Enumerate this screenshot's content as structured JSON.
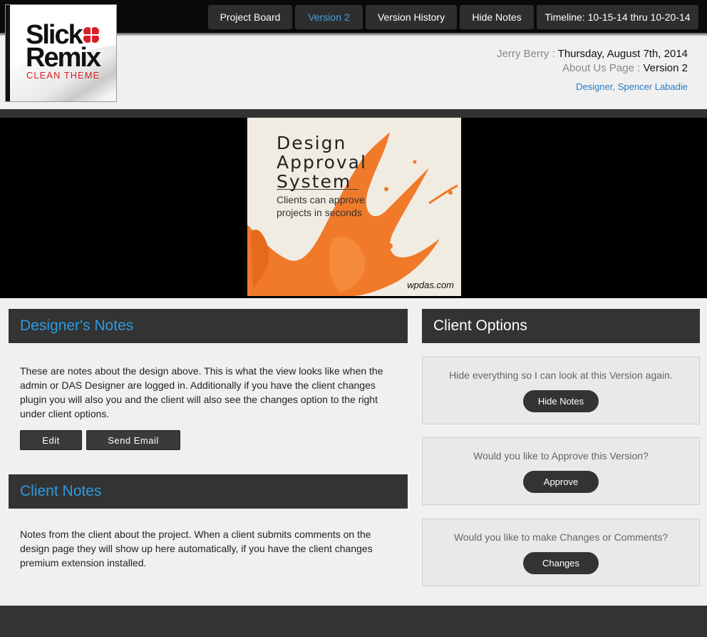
{
  "nav": [
    {
      "label": "Project Board",
      "active": false
    },
    {
      "label": "Version 2",
      "active": true
    },
    {
      "label": "Version History",
      "active": false
    },
    {
      "label": "Hide Notes",
      "active": false
    },
    {
      "label": "Timeline: 10-15-14 thru 10-20-14",
      "active": false
    }
  ],
  "logo": {
    "line1": "Slick",
    "line2": "Remix",
    "line3": "CLEAN THEME"
  },
  "meta": {
    "client": "Jerry Berry",
    "date": "Thursday, August 7th, 2014",
    "page": "About Us Page",
    "version": "Version 2",
    "separator": " : ",
    "designer": "Designer, Spencer Labadie"
  },
  "poster": {
    "title_1": "Design",
    "title_2": "Approval",
    "title_3": "System",
    "tag_1": "Clients can approve",
    "tag_2": "projects in seconds",
    "url": "wpdas.com"
  },
  "designer_notes": {
    "title": "Designer's Notes",
    "body": "These are notes about the design above. This is what the view looks like when the admin or DAS Designer are logged in. Additionally if you have the client changes plugin you will also you and the client will also see the changes option to the right under client options.",
    "edit_label": "Edit",
    "email_label": "Send Email"
  },
  "client_notes": {
    "title": "Client Notes",
    "body": "Notes from the client about the project. When a client submits comments on the design page they will show up here automatically, if you have the client changes premium extension installed."
  },
  "client_options": {
    "title": "Client Options",
    "boxes": [
      {
        "question": "Hide everything so I can look at this Version again.",
        "button": "Hide Notes"
      },
      {
        "question": "Would you like to Approve this Version?",
        "button": "Approve"
      },
      {
        "question": "Would you like to make Changes or Comments?",
        "button": "Changes"
      }
    ]
  },
  "colors": {
    "accent": "#2c9be0",
    "dark": "#333333",
    "logo_red": "#d81f26",
    "splash": "#f07a2a"
  }
}
